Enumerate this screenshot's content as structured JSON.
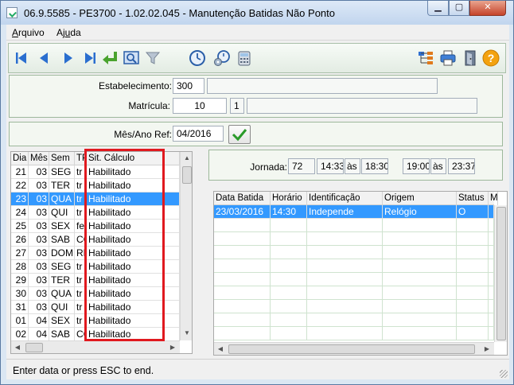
{
  "window": {
    "title": "06.9.5585 - PE3700 - 1.02.02.045 - Manutenção Batidas Não Ponto",
    "min_glyph": "▁",
    "max_glyph": "▢",
    "close_glyph": "✕"
  },
  "menu": {
    "arquivo_pre": "",
    "arquivo_u": "A",
    "arquivo_post": "rquivo",
    "ajuda_pre": "Aj",
    "ajuda_u": "u",
    "ajuda_post": "da"
  },
  "toolbar": {
    "icons": [
      "first-record-icon",
      "previous-record-icon",
      "next-record-icon",
      "last-record-icon",
      "enter-icon",
      "view-icon",
      "filter-icon",
      "clock-icon",
      "clock-gear-icon",
      "calculator-icon",
      "tree-icon",
      "print-icon",
      "exit-door-icon",
      "help-icon"
    ]
  },
  "header": {
    "estabelecimento_label": "Estabelecimento:",
    "estabelecimento_value": "300",
    "estabelecimento_desc": "",
    "matricula_label": "Matrícula:",
    "matricula_value": "10",
    "matricula_digit": "1",
    "matricula_desc": ""
  },
  "ref": {
    "label": "Mês/Ano Ref:",
    "value": "04/2016"
  },
  "days_grid": {
    "columns": [
      "Dia",
      "Mês",
      "Sem",
      "TP",
      "Sit. Cálculo"
    ],
    "rows": [
      [
        "21",
        "03",
        "SEG",
        "tr",
        "Habilitado"
      ],
      [
        "22",
        "03",
        "TER",
        "tr",
        "Habilitado"
      ],
      [
        "23",
        "03",
        "QUA",
        "tr",
        "Habilitado"
      ],
      [
        "24",
        "03",
        "QUI",
        "tr",
        "Habilitado"
      ],
      [
        "25",
        "03",
        "SEX",
        "fe",
        "Habilitado"
      ],
      [
        "26",
        "03",
        "SAB",
        "CC",
        "Habilitado"
      ],
      [
        "27",
        "03",
        "DOM",
        "RE",
        "Habilitado"
      ],
      [
        "28",
        "03",
        "SEG",
        "tr",
        "Habilitado"
      ],
      [
        "29",
        "03",
        "TER",
        "tr",
        "Habilitado"
      ],
      [
        "30",
        "03",
        "QUA",
        "tr",
        "Habilitado"
      ],
      [
        "31",
        "03",
        "QUI",
        "tr",
        "Habilitado"
      ],
      [
        "01",
        "04",
        "SEX",
        "tr",
        "Habilitado"
      ],
      [
        "02",
        "04",
        "SAB",
        "CC",
        "Habilitado"
      ]
    ],
    "selected_row": 2
  },
  "jornada": {
    "label": "Jornada:",
    "code": "72",
    "t1": "14:33",
    "sep1": "às",
    "t2": "18:30",
    "t3": "19:00",
    "sep2": "às",
    "t4": "23:37"
  },
  "punch_grid": {
    "columns": [
      "Data Batida",
      "Horário",
      "Identificação",
      "Origem",
      "Status",
      "M"
    ],
    "rows": [
      [
        "23/03/2016",
        "14:30",
        "Independe",
        "Relógio",
        "O",
        ""
      ]
    ]
  },
  "status": {
    "text": "Enter data or press ESC to end."
  }
}
